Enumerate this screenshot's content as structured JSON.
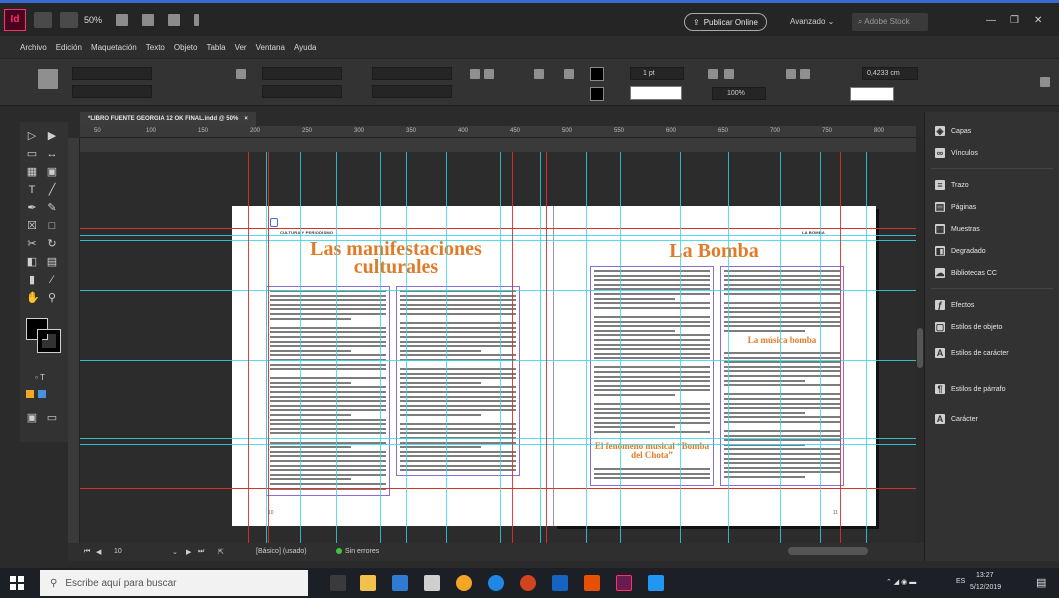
{
  "app": {
    "logo": "Id",
    "zoom": "50%",
    "publish_label": "Publicar Online",
    "workspace": "Avanzado",
    "stock_search_placeholder": "Adobe Stock",
    "window_controls": [
      "—",
      "❐",
      "✕"
    ]
  },
  "menu": [
    "Archivo",
    "Edición",
    "Maquetación",
    "Texto",
    "Objeto",
    "Tabla",
    "Ver",
    "Ventana",
    "Ayuda"
  ],
  "control": {
    "stroke_weight": "1 pt",
    "zoom_value": "100%",
    "width_value": "0,4233 cm"
  },
  "document": {
    "tab_title": "*LIBRO FUENTE GEORGIA 12 OK FINAL.indd @ 50%",
    "tab_close": "×",
    "ruler_ticks": [
      "50",
      "100",
      "150",
      "200",
      "250",
      "300",
      "350",
      "400",
      "450",
      "500",
      "550",
      "600",
      "650",
      "700",
      "750",
      "800"
    ]
  },
  "spread": {
    "left_runhead": "CULTURA Y PERIODISMO",
    "left_title": "Las manifestaciones culturales",
    "left_folio": "10",
    "right_runhead": "LA BOMBA",
    "right_title": "La Bomba",
    "right_subhead_1": "La música bomba",
    "right_subhead_2": "El fenómeno musical “Bomba del Chota”",
    "right_folio": "11"
  },
  "status": {
    "page": "10",
    "style": "[Básico] (usado)",
    "preflight": "Sin errores"
  },
  "panels": [
    {
      "icon": "layers-icon",
      "label": "Capas"
    },
    {
      "icon": "links-icon",
      "label": "Vínculos"
    },
    {
      "icon": "stroke-icon",
      "label": "Trazo"
    },
    {
      "icon": "pages-icon",
      "label": "Páginas"
    },
    {
      "icon": "swatches-icon",
      "label": "Muestras"
    },
    {
      "icon": "gradient-icon",
      "label": "Degradado"
    },
    {
      "icon": "cc-libraries-icon",
      "label": "Bibliotecas CC"
    },
    {
      "icon": "effects-icon",
      "label": "Efectos"
    },
    {
      "icon": "object-styles-icon",
      "label": "Estilos de objeto"
    },
    {
      "icon": "character-styles-icon",
      "label": "Estilos de carácter"
    },
    {
      "icon": "paragraph-styles-icon",
      "label": "Estilos de párrafo"
    },
    {
      "icon": "character-icon",
      "label": "Carácter"
    }
  ],
  "taskbar": {
    "search_placeholder": "Escribe aquí para buscar",
    "language": "ES",
    "time": "13:27",
    "date": "5/12/2019"
  },
  "colors": {
    "accent_orange": "#e07b2a",
    "guide_cyan": "#38d6e8",
    "guide_red": "#d9302e",
    "frame_purple": "#8c6cd6"
  }
}
